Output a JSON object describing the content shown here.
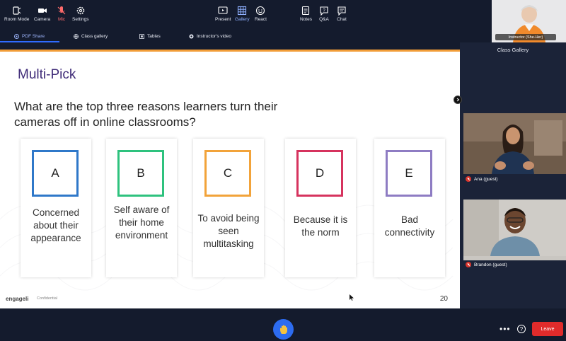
{
  "tabs": [
    {
      "label": "PDF Share",
      "icon": "pdf-share-icon",
      "active": true
    },
    {
      "label": "Class gallery",
      "icon": "globe-icon",
      "active": false
    },
    {
      "label": "Tables",
      "icon": "tables-icon",
      "active": false
    },
    {
      "label": "Instructor's video",
      "icon": "video-icon",
      "active": false
    }
  ],
  "slide": {
    "title": "Multi-Pick",
    "question": "What are the top three reasons learners turn their cameras off in online classrooms?",
    "options": [
      {
        "letter": "A",
        "text": "Concerned about their appearance",
        "color": "#2f78c9"
      },
      {
        "letter": "B",
        "text": "Self aware of their home environment",
        "color": "#2ec27e"
      },
      {
        "letter": "C",
        "text": "To avoid being seen multitasking",
        "color": "#f2a33a"
      },
      {
        "letter": "D",
        "text": "Because it is the norm",
        "color": "#d6335e"
      },
      {
        "letter": "E",
        "text": "Bad connectivity",
        "color": "#8e7cc3"
      }
    ],
    "footer_logo": "engageli",
    "footer_confidential": "Confidential",
    "page_number": "20",
    "accent_color": "#f29d38"
  },
  "instructor": {
    "label": "Instructor (She-Her)"
  },
  "gallery": {
    "title": "Class Gallery",
    "participants": [
      {
        "name": "Ana (guest)",
        "muted": true
      },
      {
        "name": "Brandon (guest)",
        "muted": true
      }
    ]
  },
  "toolbar": {
    "room_mode": "Room Mode",
    "camera": "Camera",
    "mic": "Mic",
    "settings": "Settings",
    "present": "Present",
    "gallery": "Gallery",
    "react": "React",
    "notes": "Notes",
    "qa": "Q&A",
    "chat": "Chat",
    "leave": "Leave"
  }
}
